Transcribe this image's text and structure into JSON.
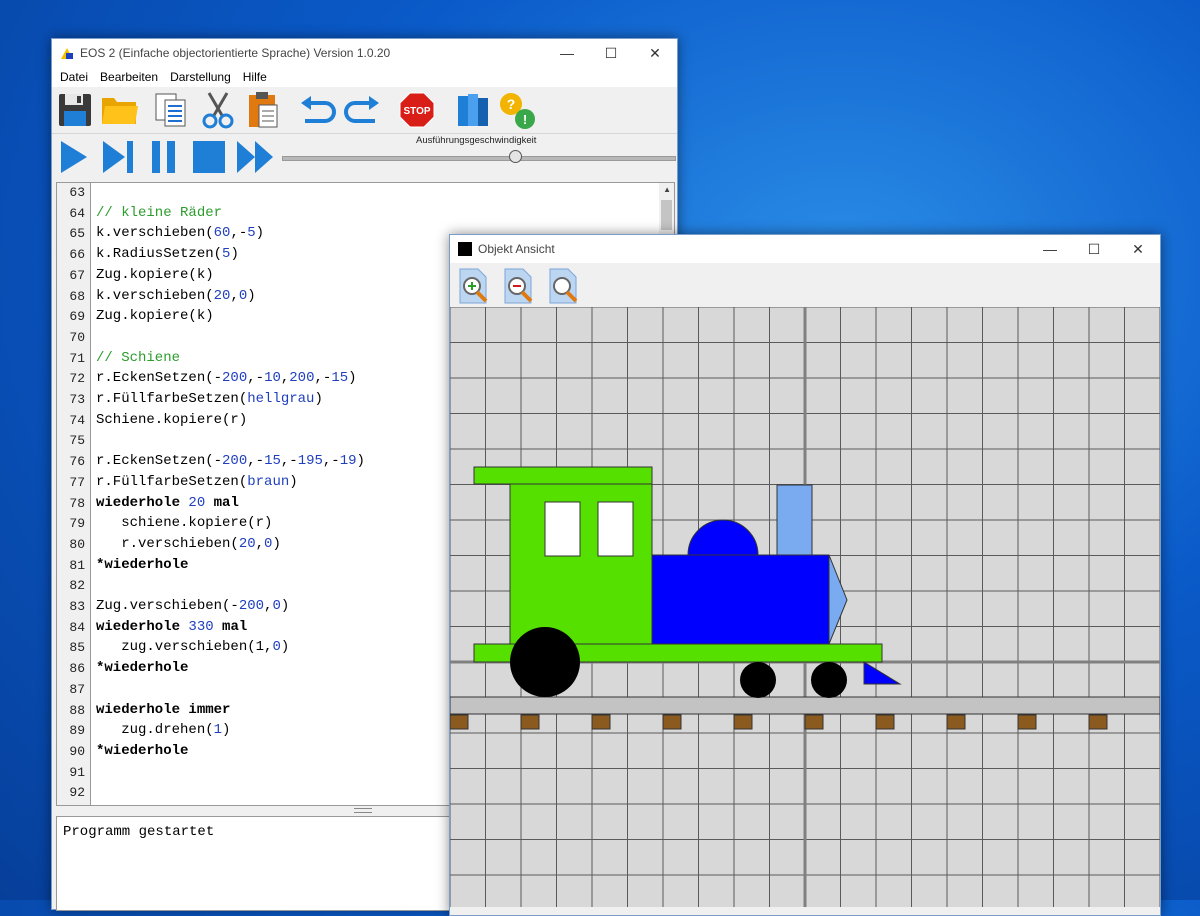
{
  "main_window": {
    "title": "EOS 2 (Einfache objectorientierte Sprache) Version 1.0.20",
    "minimize": "—",
    "maximize": "☐",
    "close": "✕",
    "menu": [
      "Datei",
      "Bearbeiten",
      "Darstellung",
      "Hilfe"
    ],
    "toolbar_icons": [
      "save-icon",
      "open-folder-icon",
      "copy-icon",
      "cut-icon",
      "paste-icon",
      "undo-icon",
      "redo-icon",
      "stop-icon",
      "book-icon",
      "help-icon"
    ],
    "stop_label": "STOP",
    "speed_label": "Ausführungsgeschwindigkeit",
    "speed_value_fraction": 0.6,
    "output_text": "Programm gestartet"
  },
  "editor": {
    "lines": [
      {
        "n": "63",
        "segs": []
      },
      {
        "n": "64",
        "segs": [
          {
            "t": "// kleine Räder",
            "c": "com"
          }
        ]
      },
      {
        "n": "65",
        "segs": [
          {
            "t": "k.verschieben(",
            "c": ""
          },
          {
            "t": "60",
            "c": "num"
          },
          {
            "t": ",-",
            "c": ""
          },
          {
            "t": "5",
            "c": "num"
          },
          {
            "t": ")",
            "c": ""
          }
        ]
      },
      {
        "n": "66",
        "segs": [
          {
            "t": "k.RadiusSetzen(",
            "c": ""
          },
          {
            "t": "5",
            "c": "num"
          },
          {
            "t": ")",
            "c": ""
          }
        ]
      },
      {
        "n": "67",
        "segs": [
          {
            "t": "Zug.kopiere(k)",
            "c": ""
          }
        ]
      },
      {
        "n": "68",
        "segs": [
          {
            "t": "k.verschieben(",
            "c": ""
          },
          {
            "t": "20",
            "c": "num"
          },
          {
            "t": ",",
            "c": ""
          },
          {
            "t": "0",
            "c": "num"
          },
          {
            "t": ")",
            "c": ""
          }
        ]
      },
      {
        "n": "69",
        "segs": [
          {
            "t": "Zug.kopiere(k)",
            "c": ""
          }
        ]
      },
      {
        "n": "70",
        "segs": []
      },
      {
        "n": "71",
        "segs": [
          {
            "t": "// Schiene",
            "c": "com"
          }
        ]
      },
      {
        "n": "72",
        "segs": [
          {
            "t": "r.EckenSetzen(-",
            "c": ""
          },
          {
            "t": "200",
            "c": "num"
          },
          {
            "t": ",-",
            "c": ""
          },
          {
            "t": "10",
            "c": "num"
          },
          {
            "t": ",",
            "c": ""
          },
          {
            "t": "200",
            "c": "num"
          },
          {
            "t": ",-",
            "c": ""
          },
          {
            "t": "15",
            "c": "num"
          },
          {
            "t": ")",
            "c": ""
          }
        ]
      },
      {
        "n": "73",
        "segs": [
          {
            "t": "r.FüllfarbeSetzen(",
            "c": ""
          },
          {
            "t": "hellgrau",
            "c": "id"
          },
          {
            "t": ")",
            "c": ""
          }
        ]
      },
      {
        "n": "74",
        "segs": [
          {
            "t": "Schiene.kopiere(r)",
            "c": ""
          }
        ]
      },
      {
        "n": "75",
        "segs": []
      },
      {
        "n": "76",
        "segs": [
          {
            "t": "r.EckenSetzen(-",
            "c": ""
          },
          {
            "t": "200",
            "c": "num"
          },
          {
            "t": ",-",
            "c": ""
          },
          {
            "t": "15",
            "c": "num"
          },
          {
            "t": ",-",
            "c": ""
          },
          {
            "t": "195",
            "c": "num"
          },
          {
            "t": ",-",
            "c": ""
          },
          {
            "t": "19",
            "c": "num"
          },
          {
            "t": ")",
            "c": ""
          }
        ]
      },
      {
        "n": "77",
        "segs": [
          {
            "t": "r.FüllfarbeSetzen(",
            "c": ""
          },
          {
            "t": "braun",
            "c": "id"
          },
          {
            "t": ")",
            "c": ""
          }
        ]
      },
      {
        "n": "78",
        "segs": [
          {
            "t": "wiederhole ",
            "c": "kw"
          },
          {
            "t": "20",
            "c": "num"
          },
          {
            "t": " mal",
            "c": "kw"
          }
        ]
      },
      {
        "n": "79",
        "segs": [
          {
            "t": "   schiene.kopiere(r)",
            "c": ""
          }
        ]
      },
      {
        "n": "80",
        "segs": [
          {
            "t": "   r.verschieben(",
            "c": ""
          },
          {
            "t": "20",
            "c": "num"
          },
          {
            "t": ",",
            "c": ""
          },
          {
            "t": "0",
            "c": "num"
          },
          {
            "t": ")",
            "c": ""
          }
        ]
      },
      {
        "n": "81",
        "segs": [
          {
            "t": "*wiederhole",
            "c": "kw"
          }
        ]
      },
      {
        "n": "82",
        "segs": []
      },
      {
        "n": "83",
        "segs": [
          {
            "t": "Zug.verschieben(-",
            "c": ""
          },
          {
            "t": "200",
            "c": "num"
          },
          {
            "t": ",",
            "c": ""
          },
          {
            "t": "0",
            "c": "num"
          },
          {
            "t": ")",
            "c": ""
          }
        ]
      },
      {
        "n": "84",
        "segs": [
          {
            "t": "wiederhole ",
            "c": "kw"
          },
          {
            "t": "330",
            "c": "num"
          },
          {
            "t": " mal",
            "c": "kw"
          }
        ]
      },
      {
        "n": "85",
        "segs": [
          {
            "t": "   zug.verschieben(",
            "c": ""
          },
          {
            "t": "1",
            "c": "hl"
          },
          {
            "t": ",",
            "c": ""
          },
          {
            "t": "0",
            "c": "num"
          },
          {
            "t": ")",
            "c": ""
          }
        ]
      },
      {
        "n": "86",
        "segs": [
          {
            "t": "*wiederhole",
            "c": "kw"
          }
        ]
      },
      {
        "n": "87",
        "segs": []
      },
      {
        "n": "88",
        "segs": [
          {
            "t": "wiederhole immer",
            "c": "kw"
          }
        ]
      },
      {
        "n": "89",
        "segs": [
          {
            "t": "   zug.drehen(",
            "c": ""
          },
          {
            "t": "1",
            "c": "num"
          },
          {
            "t": ")",
            "c": ""
          }
        ]
      },
      {
        "n": "90",
        "segs": [
          {
            "t": "*wiederhole",
            "c": "kw"
          }
        ]
      },
      {
        "n": "91",
        "segs": []
      },
      {
        "n": "92",
        "segs": []
      }
    ]
  },
  "object_view": {
    "title": "Objekt Ansicht",
    "minimize": "—",
    "maximize": "☐",
    "close": "✕",
    "zoom_buttons": [
      "zoom-in-icon",
      "zoom-out-icon",
      "zoom-reset-icon"
    ],
    "colors": {
      "grid_bg": "#d8d8d8",
      "grid_line": "#5a5a5a",
      "cab": "#55e000",
      "boiler": "#0000ff",
      "chimney": "#7aaaf0",
      "rail": "#c3c3c3",
      "sleeper": "#8b5a1e"
    }
  }
}
